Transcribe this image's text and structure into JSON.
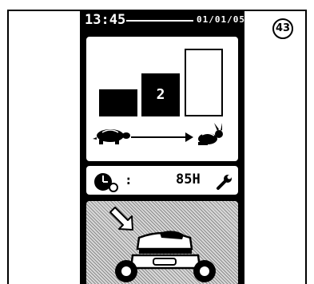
{
  "status_bar": {
    "time": "13:45",
    "date": "01/01/05"
  },
  "speed_panel": {
    "selected_level_label": "2",
    "levels_total": 3,
    "selected_level": 2,
    "slow_icon": "turtle-icon",
    "fast_icon": "rabbit-icon",
    "arrow_icon": "arrow-right-icon"
  },
  "hours_panel": {
    "clock_icon": "clock-icon",
    "separator": ":",
    "hours_value": "85H",
    "wrench_icon": "wrench-icon"
  },
  "mower_panel": {
    "arrow_icon": "arrow-down-right-icon",
    "mower_icon": "mower-icon"
  },
  "figure_badge": "43"
}
